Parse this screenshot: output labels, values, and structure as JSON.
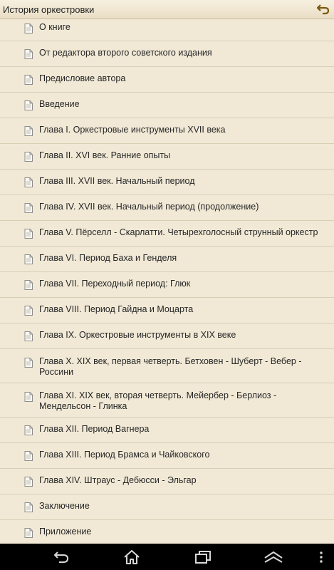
{
  "header": {
    "title": "История оркестровки",
    "back_icon": "back-arrow-icon"
  },
  "chapters": [
    {
      "label": "О книге"
    },
    {
      "label": "От редактора второго советского издания"
    },
    {
      "label": "Предисловие автора"
    },
    {
      "label": "Введение"
    },
    {
      "label": "Глава I. Оркестровые инструменты XVII века"
    },
    {
      "label": "Глава II. XVI век. Ранние опыты"
    },
    {
      "label": "Глава III. XVII век. Начальный период"
    },
    {
      "label": "Глава IV. XVII век. Начальный период (продолжение)"
    },
    {
      "label": "Глава V. Пёрселл - Скарлатти. Четырехголосный струнный оркестр"
    },
    {
      "label": "Глава VI. Период Баха и Генделя"
    },
    {
      "label": "Глава VII. Переходный период: Глюк"
    },
    {
      "label": "Глава VIII. Период Гайдна и Моцарта"
    },
    {
      "label": "Глава IX. Оркестровые инструменты в XIX веке"
    },
    {
      "label": "Глава X. XIX век, первая четверть. Бетховен - Шуберт - Вебер - Россини"
    },
    {
      "label": "Глава XI. XIX век, вторая четверть. Мейербер - Берлиоз - Мендельсон - Глинка"
    },
    {
      "label": "Глава XII. Период Вагнера"
    },
    {
      "label": "Глава XIII. Период Брамса и Чайковского"
    },
    {
      "label": "Глава XIV. Штраус - Дебюсси - Эльгар"
    },
    {
      "label": "Заключение"
    },
    {
      "label": "Приложение"
    }
  ],
  "navbar": {
    "icons": [
      "back-icon",
      "home-icon",
      "recent-apps-icon",
      "menu-up-icon",
      "more-options-icon"
    ]
  },
  "colors": {
    "background": "#f1e9d6",
    "divider": "#d9cdb3",
    "back_arrow": "#7a5a10",
    "navbar": "#000000"
  }
}
